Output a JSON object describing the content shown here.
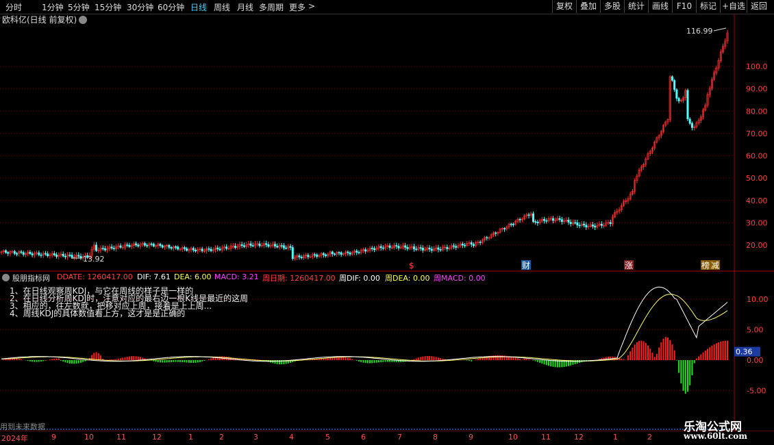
{
  "toolbar": {
    "periods": [
      "分时",
      "1分钟",
      "5分钟",
      "15分钟",
      "30分钟",
      "60分钟",
      "日线",
      "周线",
      "月线",
      "多周期",
      "更多"
    ],
    "active_period": "日线",
    "more_arrow": ">",
    "buttons": [
      "复权",
      "叠加",
      "多股",
      "统计",
      "画线",
      "F10",
      "标记",
      "+自选",
      "返回"
    ]
  },
  "main_chart": {
    "stock_title": "欧科亿(日线 前复权)",
    "high_label": "116.99",
    "low_label": "13.92",
    "price_ticks": [
      "100.0",
      "90.00",
      "80.00",
      "70.00",
      "60.00",
      "50.00",
      "40.00",
      "30.00",
      "20.00"
    ],
    "markers": [
      "$",
      "财",
      "涨",
      "榜",
      "减"
    ]
  },
  "indicator": {
    "name": "股朋指标网",
    "ddate": "DDATE: 1260417.00",
    "dif": "DIF: 7.61",
    "dea": "DEA: 6.00",
    "macd": "MACD: 3.21",
    "week_date": "周日期: 1260417.00",
    "week_dif": "周DIF: 0.00",
    "week_dea": "周DEA: 0.00",
    "week_macd": "周MACD: 0.00",
    "ticks": [
      "10.00",
      "5.00",
      "0.00",
      "-5.00"
    ],
    "current_value": "0.36"
  },
  "notes": [
    "1、在日线观察周KDJ，与它在周线的样子是一样的",
    "2、在日线分析周KDJ时，注意对应的最右边一根K线是最近的这周",
    "3、相应的，往左数就，把移对应上周，接着是上上周...",
    "4、周线KDJ的具体数值看上方，这才是是正确的"
  ],
  "footer_note": "用到未来数据",
  "watermark": {
    "line1": "乐淘公式网",
    "line2": "www.60lt.com"
  },
  "time_axis": {
    "year": "2024年",
    "months": [
      "9",
      "10",
      "11",
      "12",
      "1",
      "2",
      "3",
      "4",
      "5",
      "6",
      "7",
      "8",
      "9",
      "10",
      "11",
      "12",
      "1",
      "2"
    ]
  },
  "colors": {
    "up": "#ff3232",
    "down": "#54ffff",
    "bg": "#000000",
    "grid": "#7a0000",
    "macd_pos": "#ff2020",
    "macd_neg": "#20e020",
    "dif": "#ffffff",
    "dea": "#ffff66",
    "title_orange": "#ff4040"
  }
}
